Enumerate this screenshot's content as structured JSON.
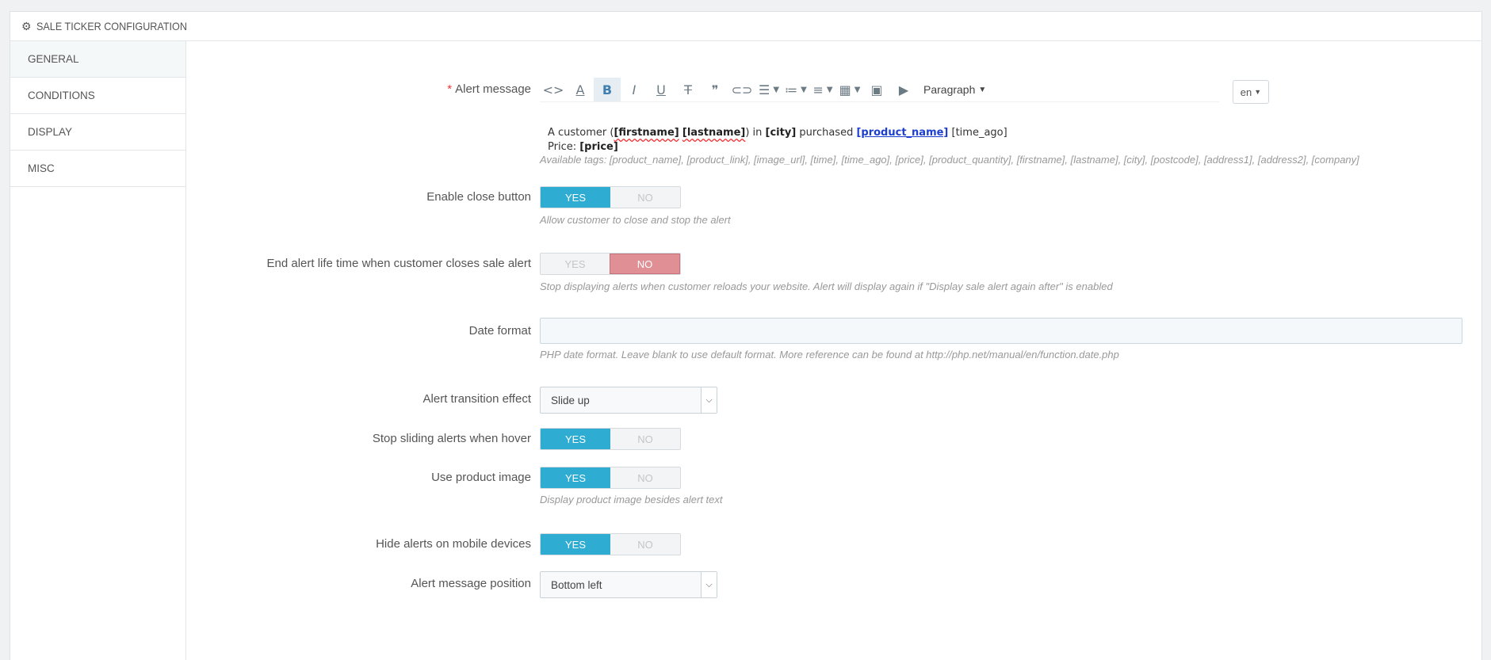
{
  "header": {
    "title": "SALE TICKER CONFIGURATION",
    "icon": "gear-icon"
  },
  "sidebar": {
    "items": [
      {
        "label": "GENERAL"
      },
      {
        "label": "CONDITIONS"
      },
      {
        "label": "DISPLAY"
      },
      {
        "label": "MISC"
      }
    ]
  },
  "alert_message": {
    "label": "Alert message",
    "required_mark": "*",
    "toolbar": {
      "paragraph_label": "Paragraph",
      "icons": [
        "code-icon",
        "text-color-icon",
        "bold-icon",
        "italic-icon",
        "underline-icon",
        "strikethrough-icon",
        "quote-icon",
        "link-icon",
        "align-icon",
        "bullet-list-icon",
        "numbered-list-icon",
        "table-icon",
        "image-icon",
        "video-icon"
      ]
    },
    "language": "en",
    "body": {
      "line1_prefix": "A customer (",
      "firstname_tag": "[firstname]",
      "lastname_tag": "[lastname]",
      "after_names": ") in ",
      "city_tag": "[city]",
      "purchased": " purchased ",
      "product_tag": "[product_name]",
      "time_tag": " [time_ago]",
      "price_label": "Price: ",
      "price_tag": "[price]"
    },
    "help": "Available tags: [product_name], [product_link], [image_url], [time], [time_ago], [price], [product_quantity], [firstname], [lastname], [city], [postcode], [address1], [address2], [company]"
  },
  "enable_close": {
    "label": "Enable close button",
    "yes": "YES",
    "no": "NO",
    "value": "yes",
    "help": "Allow customer to close and stop the alert"
  },
  "end_alert": {
    "label": "End alert life time when customer closes sale alert",
    "yes": "YES",
    "no": "NO",
    "value": "no",
    "help": "Stop displaying alerts when customer reloads your website. Alert will display again if \"Display sale alert again after\" is enabled"
  },
  "date_format": {
    "label": "Date format",
    "value": "",
    "help": "PHP date format. Leave blank to use default format. More reference can be found at http://php.net/manual/en/function.date.php"
  },
  "transition": {
    "label": "Alert transition effect",
    "value": "Slide up"
  },
  "stop_sliding": {
    "label": "Stop sliding alerts when hover",
    "yes": "YES",
    "no": "NO",
    "value": "yes"
  },
  "product_image": {
    "label": "Use product image",
    "yes": "YES",
    "no": "NO",
    "value": "yes",
    "help": "Display product image besides alert text"
  },
  "hide_mobile": {
    "label": "Hide alerts on mobile devices",
    "yes": "YES",
    "no": "NO",
    "value": "yes"
  },
  "position": {
    "label": "Alert message position",
    "value": "Bottom left"
  },
  "colors": {
    "accent": "#2eacd1",
    "danger": "#e08f95",
    "required": "#ee3333"
  }
}
